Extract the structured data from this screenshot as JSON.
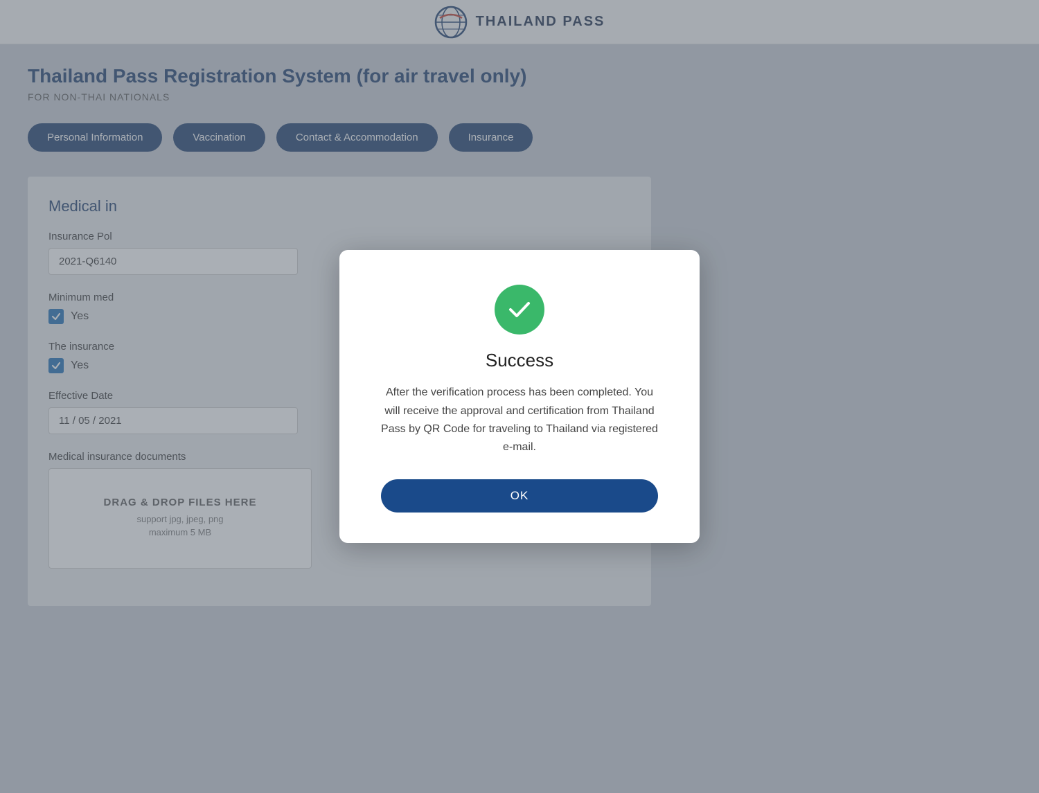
{
  "header": {
    "logo_alt": "Thailand Pass Logo",
    "title": "THAILAND PASS"
  },
  "page": {
    "title": "Thailand Pass Registration System (for air travel only)",
    "subtitle": "FOR NON-THAI NATIONALS"
  },
  "tabs": [
    {
      "id": "personal",
      "label": "Personal Information"
    },
    {
      "id": "vaccination",
      "label": "Vaccination"
    },
    {
      "id": "contact",
      "label": "Contact & Accommodation"
    },
    {
      "id": "insurance",
      "label": "Insurance"
    }
  ],
  "form": {
    "section_title": "Medical in",
    "insurance_policy_label": "Insurance Pol",
    "insurance_policy_value": "2021-Q6140",
    "minimum_med_label": "Minimum med",
    "minimum_med_checked": true,
    "minimum_med_yes": "Yes",
    "insurance_label": "The insurance",
    "insurance_checked": true,
    "insurance_yes": "Yes",
    "effective_date_label": "Effective Date",
    "effective_date_value": "11 / 05 / 2021",
    "docs_label": "Medical insurance documents",
    "drop_zone_title": "DRAG & DROP FILES HERE",
    "drop_zone_support": "support jpg, jpeg, png",
    "drop_zone_size": "maximum 5 MB"
  },
  "modal": {
    "title": "Success",
    "message": "After the verification process has been completed. You will receive the approval and certification from Thailand Pass by QR Code for traveling to Thailand via registered e-mail.",
    "ok_label": "OK"
  }
}
